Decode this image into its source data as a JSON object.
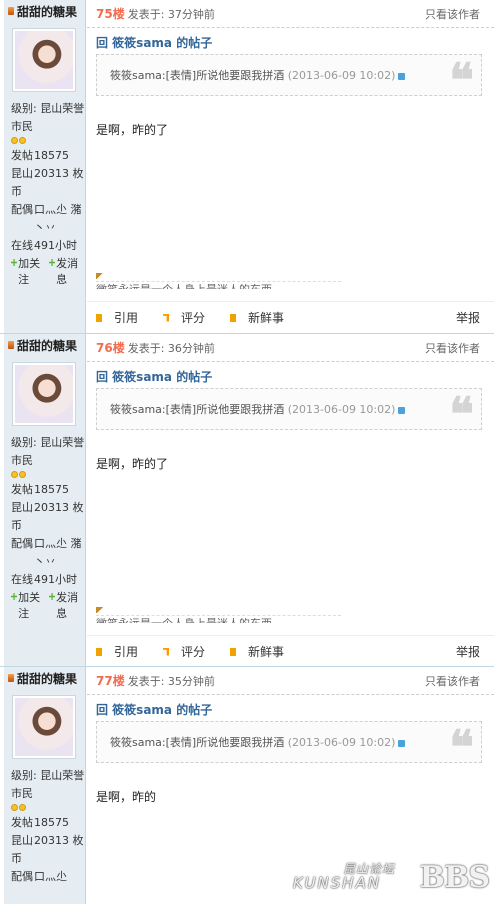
{
  "posts": [
    {
      "username": "甜甜的糖果",
      "floor": "75楼",
      "time": "发表于: 37分钟前",
      "only_author": "只看该作者",
      "reply_title": "回 筱筱sama 的帖子",
      "quote_text": "筱筱sama:[表情]所说他要跟我拼酒",
      "quote_time": "(2013-06-09 10:02)",
      "quote_mark": "❝",
      "body": "是啊，昨的了",
      "signature": "微笑永远是一个人身上最迷人的东西",
      "level_label": "级别: 昆山荣誉市民",
      "stats": [
        {
          "k": "发帖",
          "v": "18575"
        },
        {
          "k": "昆山币",
          "v": "20313 枚"
        },
        {
          "k": "配偶",
          "v": "口灬尐 潴丶丷"
        },
        {
          "k": "在线",
          "v": "491小时"
        }
      ],
      "add_follow": "加关注",
      "send_msg": "发消息",
      "quote_btn": "引用",
      "rate_btn": "评分",
      "fresh_btn": "新鲜事",
      "report_btn": "举报"
    },
    {
      "username": "甜甜的糖果",
      "floor": "76楼",
      "time": "发表于: 36分钟前",
      "only_author": "只看该作者",
      "reply_title": "回 筱筱sama 的帖子",
      "quote_text": "筱筱sama:[表情]所说他要跟我拼酒",
      "quote_time": "(2013-06-09 10:02)",
      "quote_mark": "❝",
      "body": "是啊，昨的了",
      "signature": "微笑永远是一个人身上最迷人的东西",
      "level_label": "级别: 昆山荣誉市民",
      "stats": [
        {
          "k": "发帖",
          "v": "18575"
        },
        {
          "k": "昆山币",
          "v": "20313 枚"
        },
        {
          "k": "配偶",
          "v": "口灬尐 潴丶丷"
        },
        {
          "k": "在线",
          "v": "491小时"
        }
      ],
      "add_follow": "加关注",
      "send_msg": "发消息",
      "quote_btn": "引用",
      "rate_btn": "评分",
      "fresh_btn": "新鲜事",
      "report_btn": "举报"
    },
    {
      "username": "甜甜的糖果",
      "floor": "77楼",
      "time": "发表于: 35分钟前",
      "only_author": "只看该作者",
      "reply_title": "回 筱筱sama 的帖子",
      "quote_text": "筱筱sama:[表情]所说他要跟我拼酒",
      "quote_time": "(2013-06-09 10:02)",
      "quote_mark": "❝",
      "body": "是啊，昨的",
      "level_label": "级别: 昆山荣誉市民",
      "stats": [
        {
          "k": "发帖",
          "v": "18575"
        },
        {
          "k": "昆山币",
          "v": "20313 枚"
        },
        {
          "k": "配偶",
          "v": "口灬尐"
        }
      ]
    }
  ],
  "watermark": {
    "cn": "昆山论坛",
    "en": "KUNSHAN",
    "bbs": "BBS"
  }
}
